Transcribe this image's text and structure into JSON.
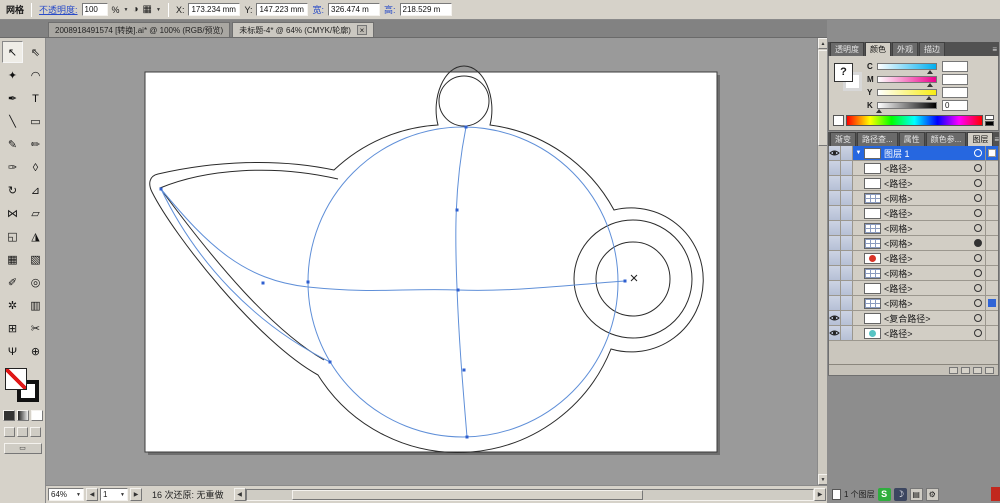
{
  "colors": {
    "chrome": "#d6d2c9",
    "canvas_bg": "#9a9a9a",
    "selection_blue": "#2667e0",
    "mesh_blue": "#5f8fd8",
    "link_blue": "#2a4cc8",
    "thumb_red": "#d93327",
    "thumb_teal": "#57c4c4",
    "ime_green": "#2fae3e"
  },
  "icons": {
    "close": "×",
    "dropdown": "▼",
    "menu": "≡",
    "up": "▲",
    "down": "▼",
    "left": "◀",
    "right": "▶",
    "keyboard": "▤",
    "gear": "⚙",
    "half_circle": "◑",
    "grid": "▦",
    "question": "?"
  },
  "options_bar": {
    "tool_label": "网格",
    "opacity_label": "不透明度:",
    "opacity_value": "100",
    "percent": "%",
    "x_label": "X:",
    "x_value": "173.234 mm",
    "y_label": "Y:",
    "y_value": "147.223 mm",
    "w_label": "宽:",
    "w_value": "326.474 m",
    "h_label": "高:",
    "h_value": "218.529 m"
  },
  "document_tabs": [
    {
      "label": "2008918491574 [转换].ai* @ 100% (RGB/预览)",
      "active": false
    },
    {
      "label": "未标题-4* @ 64% (CMYK/轮廓)",
      "active": true
    }
  ],
  "toolbar": {
    "tools": [
      {
        "name": "selection-tool",
        "glyph": "↖",
        "selected": true
      },
      {
        "name": "direct-selection-tool",
        "glyph": "⇖"
      },
      {
        "name": "magic-wand-tool",
        "glyph": "✦"
      },
      {
        "name": "lasso-tool",
        "glyph": "◠"
      },
      {
        "name": "pen-tool",
        "glyph": "✒"
      },
      {
        "name": "type-tool",
        "glyph": "T"
      },
      {
        "name": "line-segment-tool",
        "glyph": "╲"
      },
      {
        "name": "rectangle-tool",
        "glyph": "▭"
      },
      {
        "name": "paintbrush-tool",
        "glyph": "✎"
      },
      {
        "name": "pencil-tool",
        "glyph": "✏"
      },
      {
        "name": "blob-brush-tool",
        "glyph": "✑"
      },
      {
        "name": "eraser-tool",
        "glyph": "◊"
      },
      {
        "name": "rotate-tool",
        "glyph": "↻"
      },
      {
        "name": "scale-tool",
        "glyph": "⊿"
      },
      {
        "name": "width-tool",
        "glyph": "⋈"
      },
      {
        "name": "free-transform-tool",
        "glyph": "▱"
      },
      {
        "name": "shape-builder-tool",
        "glyph": "◱"
      },
      {
        "name": "perspective-grid-tool",
        "glyph": "◮"
      },
      {
        "name": "mesh-tool",
        "glyph": "▦"
      },
      {
        "name": "gradient-tool",
        "glyph": "▧"
      },
      {
        "name": "eyedropper-tool",
        "glyph": "✐"
      },
      {
        "name": "blend-tool",
        "glyph": "◎"
      },
      {
        "name": "symbol-sprayer-tool",
        "glyph": "✲"
      },
      {
        "name": "column-graph-tool",
        "glyph": "▥"
      },
      {
        "name": "artboard-tool",
        "glyph": "⊞"
      },
      {
        "name": "slice-tool",
        "glyph": "✂"
      },
      {
        "name": "hand-tool",
        "glyph": "Ψ"
      },
      {
        "name": "zoom-tool",
        "glyph": "⊕"
      }
    ]
  },
  "panels": {
    "group1": {
      "tabs": [
        {
          "label": "透明度",
          "active": false
        },
        {
          "label": "颜色",
          "active": true
        },
        {
          "label": "外观",
          "active": false
        },
        {
          "label": "描边",
          "active": false
        }
      ],
      "color_panel": {
        "proxy_symbol": "?",
        "channels": [
          {
            "label": "C",
            "value": "",
            "marker": 90
          },
          {
            "label": "M",
            "value": "",
            "marker": 90
          },
          {
            "label": "Y",
            "value": "",
            "marker": 88
          },
          {
            "label": "K",
            "value": "0",
            "marker": 2
          }
        ]
      }
    },
    "group2": {
      "tabs": [
        {
          "label": "渐变",
          "active": false
        },
        {
          "label": "路径查...",
          "active": false
        },
        {
          "label": "属性",
          "active": false
        },
        {
          "label": "颜色参...",
          "active": false
        },
        {
          "label": "图层",
          "active": true
        }
      ],
      "layers": {
        "rows": [
          {
            "name": "图层 1",
            "layer": true,
            "eye": true,
            "selected": true,
            "thumb": "white",
            "target": "ring",
            "chip": "outline"
          },
          {
            "name": "<路径>",
            "thumb": "white",
            "target": "ring"
          },
          {
            "name": "<路径>",
            "thumb": "white",
            "target": "ring"
          },
          {
            "name": "<网格>",
            "thumb": "mesh",
            "target": "ring"
          },
          {
            "name": "<路径>",
            "thumb": "white",
            "target": "ring"
          },
          {
            "name": "<网格>",
            "thumb": "mesh",
            "target": "ring"
          },
          {
            "name": "<网格>",
            "thumb": "mesh",
            "target": "filled"
          },
          {
            "name": "<路径>",
            "thumb": "red",
            "target": "ring"
          },
          {
            "name": "<网格>",
            "thumb": "mesh",
            "target": "ring"
          },
          {
            "name": "<路径>",
            "thumb": "white",
            "target": "ring"
          },
          {
            "name": "<网格>",
            "thumb": "mesh",
            "target": "ring",
            "chip": true
          },
          {
            "name": "<复合路径>",
            "eye": true,
            "thumb": "white",
            "target": "ring"
          },
          {
            "name": "<路径>",
            "eye": true,
            "thumb": "teal",
            "target": "ring"
          }
        ]
      }
    }
  },
  "status_bar": {
    "zoom": "64%",
    "page": "1",
    "undo_status": "16 次还原: 无重做"
  },
  "tray": {
    "layers_info": "1 个图层",
    "ime_badge": "S",
    "moon": "☽"
  }
}
